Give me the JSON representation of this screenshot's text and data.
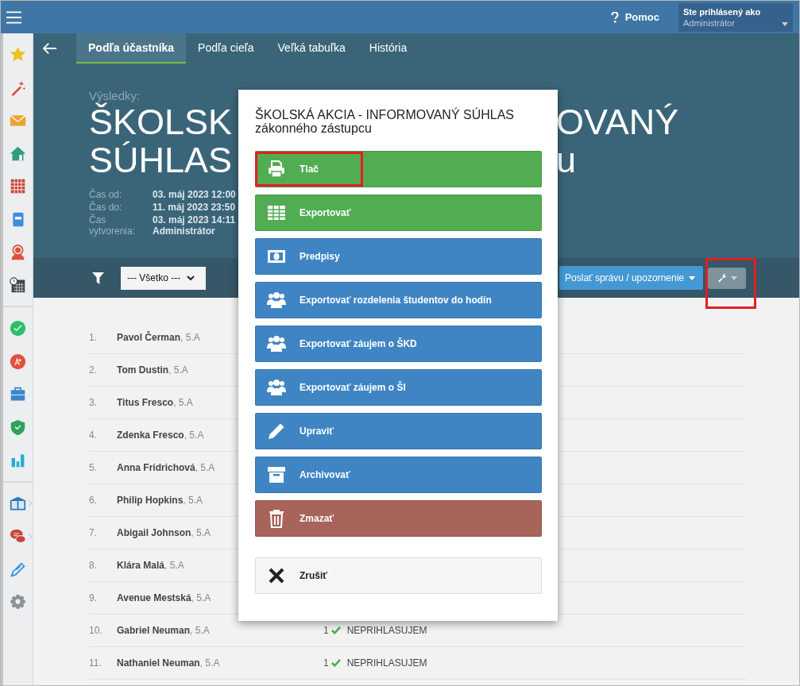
{
  "topbar": {
    "help": "Pomoc",
    "user_label": "Ste prihlásený ako",
    "user_name": "Administrátor"
  },
  "tabs": [
    {
      "label": "Podľa účastníka",
      "selected": true
    },
    {
      "label": "Podľa cieľa",
      "selected": false
    },
    {
      "label": "Veľká tabuľka",
      "selected": false
    },
    {
      "label": "História",
      "selected": false
    }
  ],
  "header": {
    "label": "Výsledky:",
    "title_left": [
      "ŠKOLSK",
      "SÚHLAS"
    ],
    "title_right": [
      "OVANÝ",
      "u"
    ],
    "meta": [
      {
        "label": "Čas od:",
        "values": [
          "03. máj 2023 12:00"
        ]
      },
      {
        "label": "Čas do:",
        "values": [
          "11. máj 2023 23:50"
        ]
      },
      {
        "label": "Čas vytvorenia:",
        "values": [
          "03. máj 2023 14:11",
          "Administrátor"
        ]
      }
    ]
  },
  "toolbar": {
    "filter_value": "--- Všetko ---",
    "send_button": "Poslať správu / upozornenie",
    "tools_highlighted": true
  },
  "participants": [
    {
      "number": "1.",
      "name": "Pavol Čerman",
      "class": ", 5.A"
    },
    {
      "number": "2.",
      "name": "Tom Dustin",
      "class": ", 5.A"
    },
    {
      "number": "3.",
      "name": "Titus Fresco",
      "class": ", 5.A"
    },
    {
      "number": "4.",
      "name": "Zdenka Fresco",
      "class": ", 5.A"
    },
    {
      "number": "5.",
      "name": "Anna Fridrichová",
      "class": ", 5.A"
    },
    {
      "number": "6.",
      "name": "Philip Hopkins",
      "class": ", 5.A"
    },
    {
      "number": "7.",
      "name": "Abigail Johnson",
      "class": ", 5.A"
    },
    {
      "number": "8.",
      "name": "Klára Malá",
      "class": ", 5.A"
    },
    {
      "number": "9.",
      "name": "Avenue Mestská",
      "class": ", 5.A"
    },
    {
      "number": "10.",
      "name": "Gabriel Neuman",
      "class": ", 5.A",
      "count": "1",
      "status": "NEPRIHLASUJEM"
    },
    {
      "number": "11.",
      "name": "Nathaniel Neuman",
      "class": ", 5.A",
      "count": "1",
      "status": "NEPRIHLASUJEM"
    }
  ],
  "dialog": {
    "title": "ŠKOLSKÁ AKCIA - INFORMOVANÝ SÚHLAS",
    "subtitle": "zákonného zástupcu",
    "actions": [
      {
        "label": "Tlač",
        "kind": "print",
        "highlighted": true
      },
      {
        "label": "Exportovať",
        "kind": "table",
        "highlighted": false
      },
      {
        "label": "Predpisy",
        "kind": "money",
        "highlighted": false
      },
      {
        "label": "Exportovať rozdelenia študentov do hodín",
        "kind": "group",
        "highlighted": false
      },
      {
        "label": "Exportovať záujem o ŠKD",
        "kind": "group",
        "highlighted": false
      },
      {
        "label": "Exportovať záujem o ŠI",
        "kind": "group",
        "highlighted": false
      },
      {
        "label": "Upraviť",
        "kind": "pencil",
        "highlighted": false
      },
      {
        "label": "Archivovať",
        "kind": "archive",
        "highlighted": false
      },
      {
        "label": "Zmazať",
        "kind": "trash",
        "highlighted": false
      },
      {
        "label": "Zrušiť",
        "kind": "close",
        "highlighted": false
      }
    ]
  }
}
